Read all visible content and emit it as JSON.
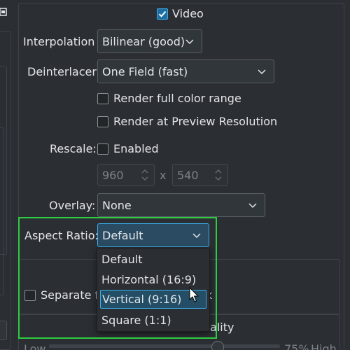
{
  "video_checkbox": {
    "label": "Video",
    "checked": true
  },
  "interpolation": {
    "label": "Interpolation",
    "value": "Bilinear (good)"
  },
  "deinterlacer": {
    "label": "Deinterlacer",
    "value": "One Field (fast)"
  },
  "render_full_color": {
    "label": "Render full color range",
    "checked": false
  },
  "render_preview": {
    "label": "Render at Preview Resolution",
    "checked": false
  },
  "rescale": {
    "label": "Rescale:",
    "enabled_label": "Enabled",
    "enabled": false,
    "width": "960",
    "separator": "x",
    "height": "540"
  },
  "overlay": {
    "label": "Overlay:",
    "value": "None"
  },
  "aspect_ratio": {
    "label": "Aspect Ratio:",
    "value": "Default",
    "options": [
      "Default",
      "Horizontal (16:9)",
      "Vertical (9:16)",
      "Square (1:1)"
    ],
    "highlighted_option": "Vertical (9:16)"
  },
  "separate_fields": {
    "label_prefix": "Separate fi",
    "label_suffix": "k",
    "checked": false
  },
  "quality": {
    "label_fragment": "ality",
    "low_label": "Low",
    "value_text": "75%",
    "high_label": "High",
    "value_fraction": 0.75
  },
  "colors": {
    "accent": "#3daee9",
    "highlight_box": "#2ecc40",
    "background": "#2b2e33"
  }
}
